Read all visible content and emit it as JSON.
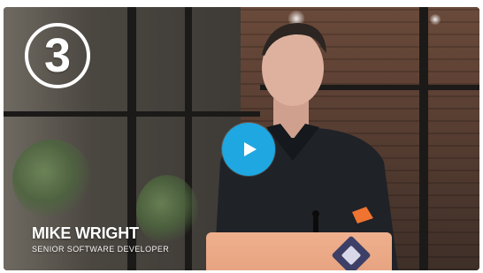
{
  "video": {
    "episode_number": "3",
    "speaker_name": "MIKE WRIGHT",
    "speaker_title": "SENIOR SOFTWARE DEVELOPER"
  },
  "icons": {
    "play": "play-icon"
  },
  "colors": {
    "play_button": "#1ea7e1",
    "overlay_text": "#ffffff"
  }
}
